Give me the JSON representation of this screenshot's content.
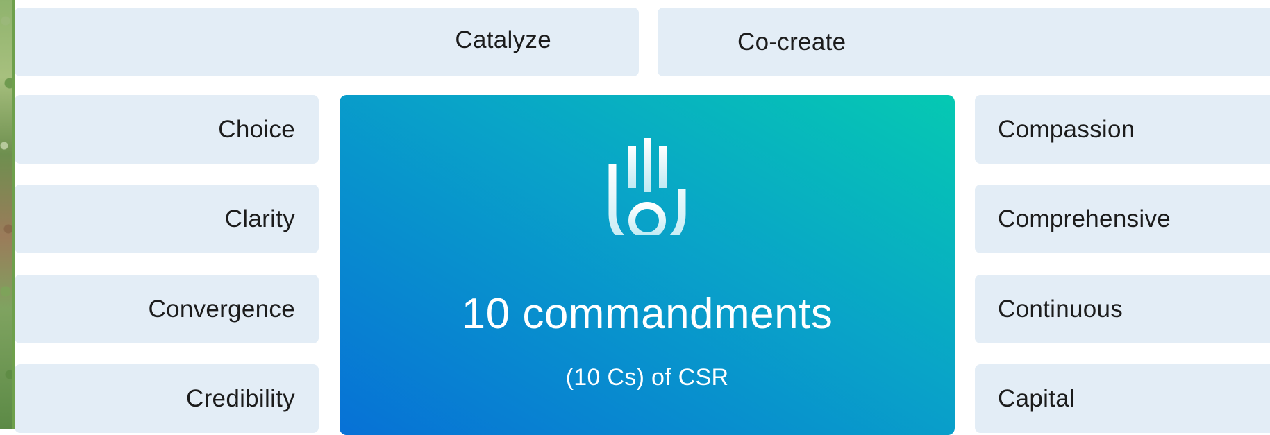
{
  "top": {
    "left_label": "Catalyze",
    "right_label": "Co-create"
  },
  "left_items": [
    "Choice",
    "Clarity",
    "Convergence",
    "Credibility"
  ],
  "right_items": [
    "Compassion",
    "Comprehensive",
    "Continuous",
    "Capital"
  ],
  "center": {
    "icon": "hand-icon",
    "title": "10 commandments",
    "subtitle": "(10 Cs) of CSR"
  },
  "colors": {
    "box_bg": "#e3edf6",
    "text": "#1c1c1c",
    "gradient_start": "#0771d6",
    "gradient_end": "#05c9b2",
    "center_text": "#ffffff"
  }
}
